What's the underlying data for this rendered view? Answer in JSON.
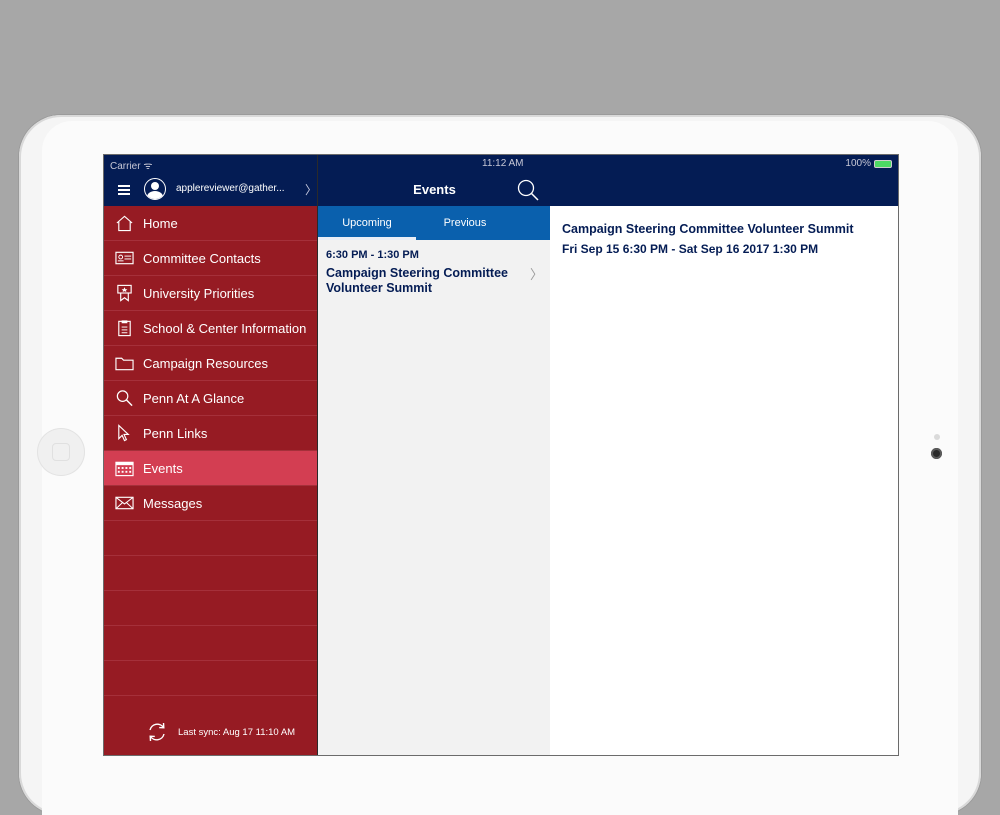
{
  "status_bar": {
    "carrier": "Carrier ᯤ",
    "time": "11:12 AM",
    "battery": "100%"
  },
  "sidebar": {
    "user_email": "applereviewer@gather...",
    "items": [
      {
        "label": "Home",
        "icon": "home-icon"
      },
      {
        "label": "Committee Contacts",
        "icon": "contact-card-icon"
      },
      {
        "label": "University Priorities",
        "icon": "award-ribbon-icon"
      },
      {
        "label": "School & Center Information",
        "icon": "clipboard-icon"
      },
      {
        "label": "Campaign Resources",
        "icon": "folder-icon"
      },
      {
        "label": "Penn At A Glance",
        "icon": "magnifier-icon"
      },
      {
        "label": "Penn Links",
        "icon": "pointer-icon"
      },
      {
        "label": "Events",
        "icon": "calendar-icon",
        "active": true
      },
      {
        "label": "Messages",
        "icon": "envelope-icon"
      }
    ],
    "last_sync": "Last sync:  Aug 17 11:10 AM"
  },
  "middle": {
    "title": "Events",
    "tabs": [
      {
        "label": "Upcoming",
        "selected": true
      },
      {
        "label": "Previous"
      }
    ],
    "events": [
      {
        "time": "6:30 PM - 1:30 PM",
        "title": "Campaign Steering Committee Volunteer Summit"
      }
    ]
  },
  "detail": {
    "title": "Campaign Steering Committee Volunteer Summit",
    "date": "Fri  Sep 15 6:30 PM - Sat  Sep 16 2017 1:30 PM"
  },
  "colors": {
    "navy": "#041c54",
    "sidebar_red": "#961b23",
    "active_item": "#d33e52",
    "tab_blue": "#0a60ad"
  }
}
